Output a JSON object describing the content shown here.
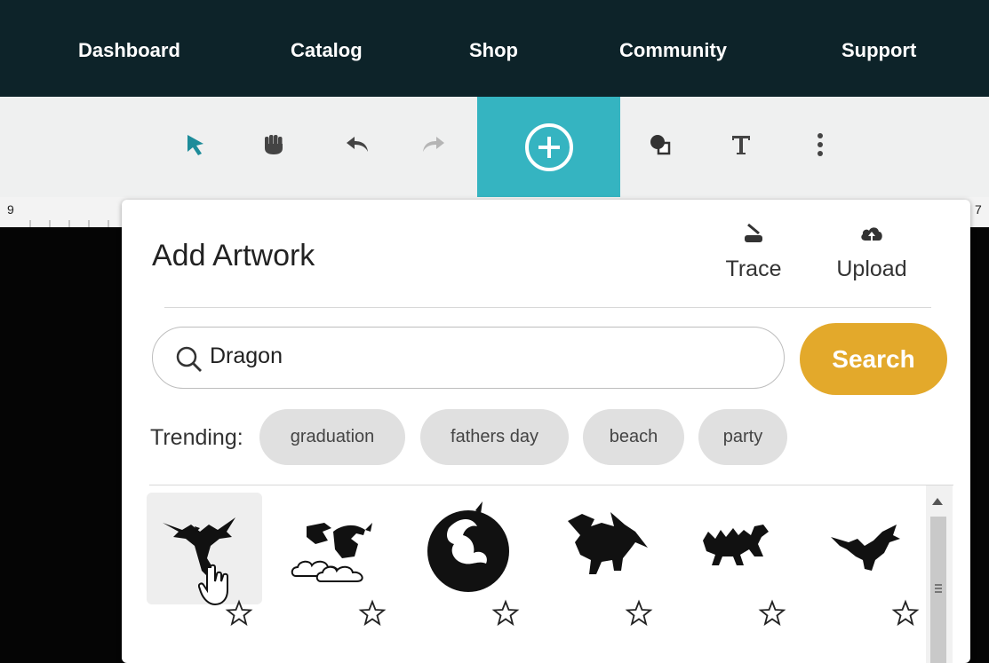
{
  "nav": {
    "items": [
      "Dashboard",
      "Catalog",
      "Shop",
      "Community",
      "Support"
    ]
  },
  "toolbar": {
    "icons": [
      "select-arrow-icon",
      "hand-icon",
      "undo-icon",
      "redo-icon",
      "add-icon",
      "shapes-icon",
      "text-icon",
      "more-icon"
    ],
    "accent": "#35b4c1"
  },
  "ruler": {
    "left_number": "9",
    "right_number": "7"
  },
  "panel": {
    "title": "Add Artwork",
    "trace_label": "Trace",
    "upload_label": "Upload",
    "search": {
      "value": "Dragon",
      "button_label": "Search"
    },
    "trending": {
      "label": "Trending:",
      "chips": [
        "graduation",
        "fathers day",
        "beach",
        "party"
      ]
    },
    "results": [
      "dragon-1",
      "dragon-2",
      "dragon-3",
      "dragon-4",
      "dragon-5",
      "dragon-6"
    ]
  },
  "colors": {
    "nav_bg": "#0d2329",
    "search_button": "#e3a92b"
  }
}
